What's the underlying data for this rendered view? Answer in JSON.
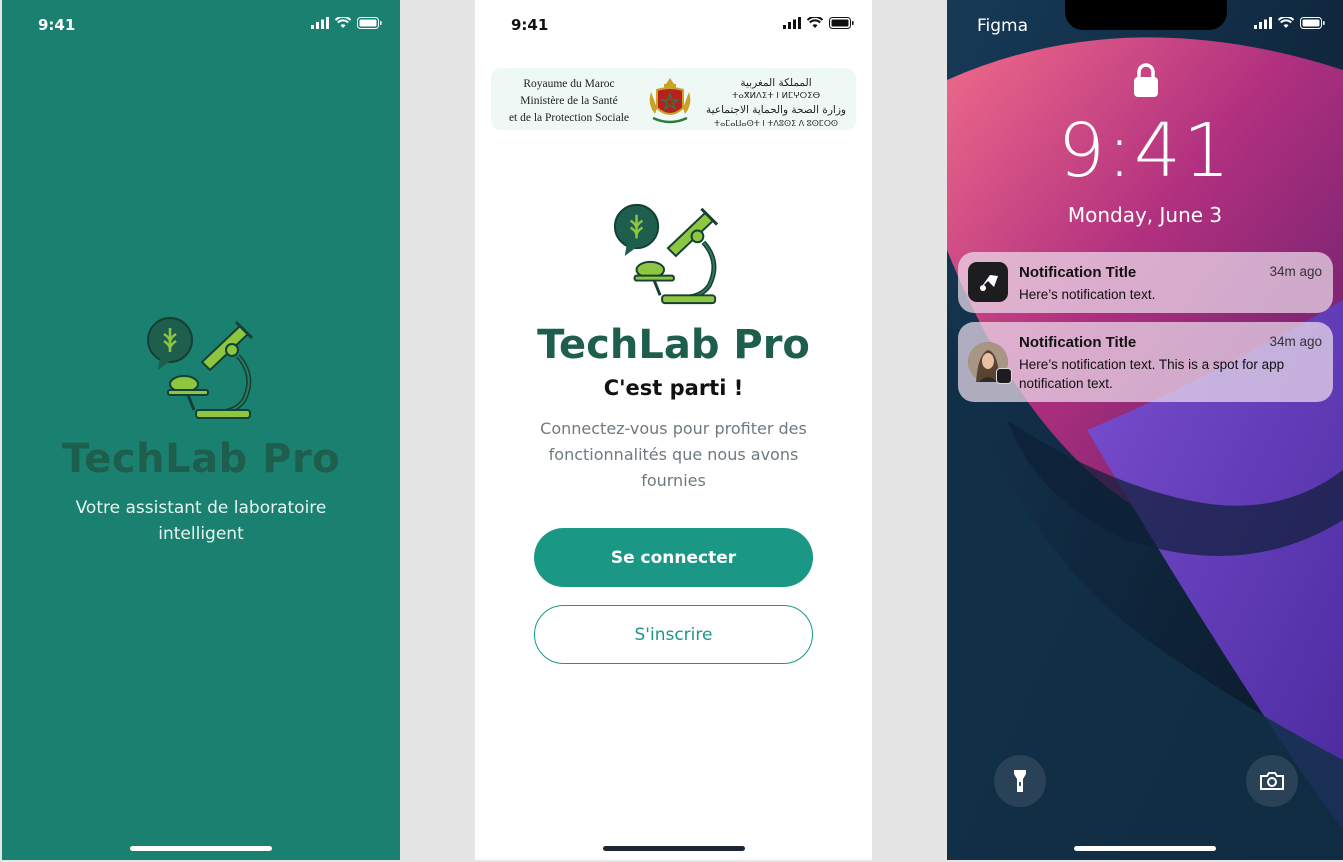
{
  "splash": {
    "time": "9:41",
    "title": "TechLab Pro",
    "tagline": "Votre assistant de laboratoire intelligent"
  },
  "login": {
    "time": "9:41",
    "ministry_fr": [
      "Royaume du Maroc",
      "Ministère de la Santé",
      "et de la Protection Sociale"
    ],
    "ministry_ar": [
      "المملكة المغربية",
      "ⵜⴰⴳⵍⴷⵉⵜ ⵏ ⵍⵎⵖⵔⵉⴱ",
      "وزارة الصحة والحماية الاجتماعية",
      "ⵜⴰⵎⴰⵡⴰⵙⵜ ⵏ ⵜⴷⵓⵙⵉ ⴷ ⵓⵙⵎⵔⵙ ⴰⵏⴰⵎⵓⵏ"
    ],
    "title": "TechLab Pro",
    "subtitle": "C'est parti !",
    "description": "Connectez-vous pour profiter des fonctionnalités que nous avons fournies",
    "login_button": "Se connecter",
    "signup_button": "S'inscrire"
  },
  "lockscreen": {
    "carrier": "Figma",
    "time": "9:41",
    "date": "Monday, June 3",
    "notifications": [
      {
        "title": "Notification Title",
        "age": "34m ago",
        "body": "Here’s notification text.",
        "icon": "figma-app-icon"
      },
      {
        "title": "Notification Title",
        "age": "34m ago",
        "body": "Here’s notification text. This is a spot for app notification text.",
        "icon": "contact-avatar"
      }
    ],
    "left_button_icon": "flashlight-icon",
    "right_button_icon": "camera-icon"
  },
  "colors": {
    "splash_bg": "#1a8170",
    "brand_dark": "#1e5e4d",
    "primary": "#1a9885",
    "brand_light": "#8dc63f"
  }
}
